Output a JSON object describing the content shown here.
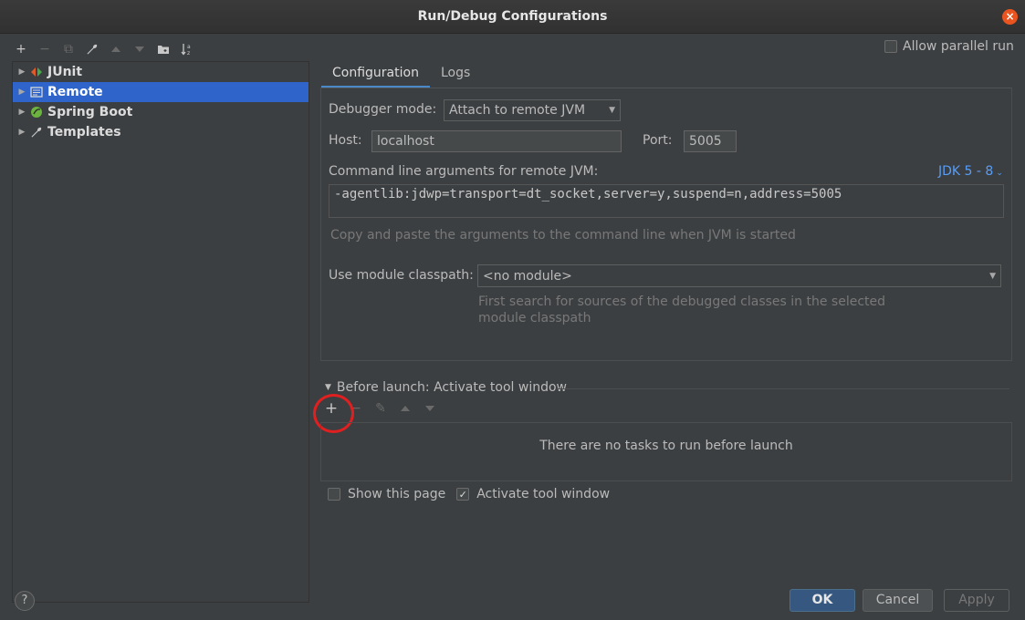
{
  "window": {
    "title": "Run/Debug Configurations",
    "close_glyph": "×"
  },
  "toolbar": {
    "icons": [
      "add-icon",
      "remove-icon",
      "copy-icon",
      "wrench-icon",
      "move-up-icon",
      "move-down-icon",
      "folder-icon",
      "sort-icon"
    ],
    "add_glyph": "+",
    "remove_glyph": "−",
    "copy_glyph": "⧉",
    "wrench_glyph": "🔧",
    "up_glyph": "▲",
    "down_glyph": "▼",
    "folder_glyph": "📁",
    "sort_glyph": "↓ᵃ"
  },
  "tree": {
    "items": [
      {
        "label": "JUnit",
        "icon": "junit-icon"
      },
      {
        "label": "Remote",
        "icon": "remote-icon",
        "selected": true
      },
      {
        "label": "Spring Boot",
        "icon": "spring-boot-icon"
      },
      {
        "label": "Templates",
        "icon": "wrench-icon"
      }
    ]
  },
  "allow_parallel": {
    "label": "Allow parallel run",
    "checked": false
  },
  "tabs": [
    {
      "label": "Configuration",
      "active": true
    },
    {
      "label": "Logs",
      "active": false
    }
  ],
  "config": {
    "debugger_mode_label": "Debugger mode:",
    "debugger_mode_value": "Attach to remote JVM",
    "host_label": "Host:",
    "host_value": "localhost",
    "port_label": "Port:",
    "port_value": "5005",
    "cmd_label": "Command line arguments for remote JVM:",
    "jdk_link": "JDK 5 - 8",
    "cmd_value": "-agentlib:jdwp=transport=dt_socket,server=y,suspend=n,address=5005",
    "cmd_hint": "Copy and paste the arguments to the command line when JVM is started",
    "module_label": "Use module classpath:",
    "module_value": "<no module>",
    "module_hint_1": "First search for sources of the debugged classes in the selected",
    "module_hint_2": "module classpath"
  },
  "before_launch": {
    "title": "Before launch: Activate tool window",
    "empty_text": "There are no tasks to run before launch",
    "add_glyph": "+",
    "remove_glyph": "−",
    "edit_glyph": "✎",
    "up_glyph": "▲",
    "down_glyph": "▼"
  },
  "options": {
    "show_page": {
      "label": "Show this page",
      "checked": false
    },
    "activate_tool_window": {
      "label": "Activate tool window",
      "checked": true,
      "mark": "✓"
    }
  },
  "buttons": {
    "help": "?",
    "ok": "OK",
    "cancel": "Cancel",
    "apply": "Apply"
  },
  "colors": {
    "accent": "#2f65ca",
    "link": "#589df6",
    "highlight_circle": "#e02020",
    "close": "#e95420"
  }
}
